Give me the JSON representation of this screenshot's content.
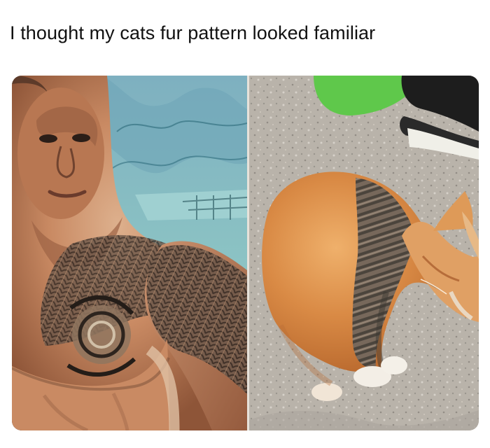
{
  "post": {
    "caption": "I thought my cats fur pattern looked familiar"
  },
  "image": {
    "left_panel": {
      "subject": "tattooed-man-photo-icon"
    },
    "right_panel": {
      "subject": "orange-tabby-cat-photo-icon"
    }
  },
  "colors": {
    "background": "#ffffff",
    "caption_text": "#111111",
    "skin": "#c98a63",
    "tattoo": "#4d4038",
    "cat_orange": "#d98a45",
    "cat_stripes": "#77685b",
    "ground": "#b9b3aa",
    "sky_blue": "#7fb5c1",
    "green_bag": "#5fc84b"
  }
}
